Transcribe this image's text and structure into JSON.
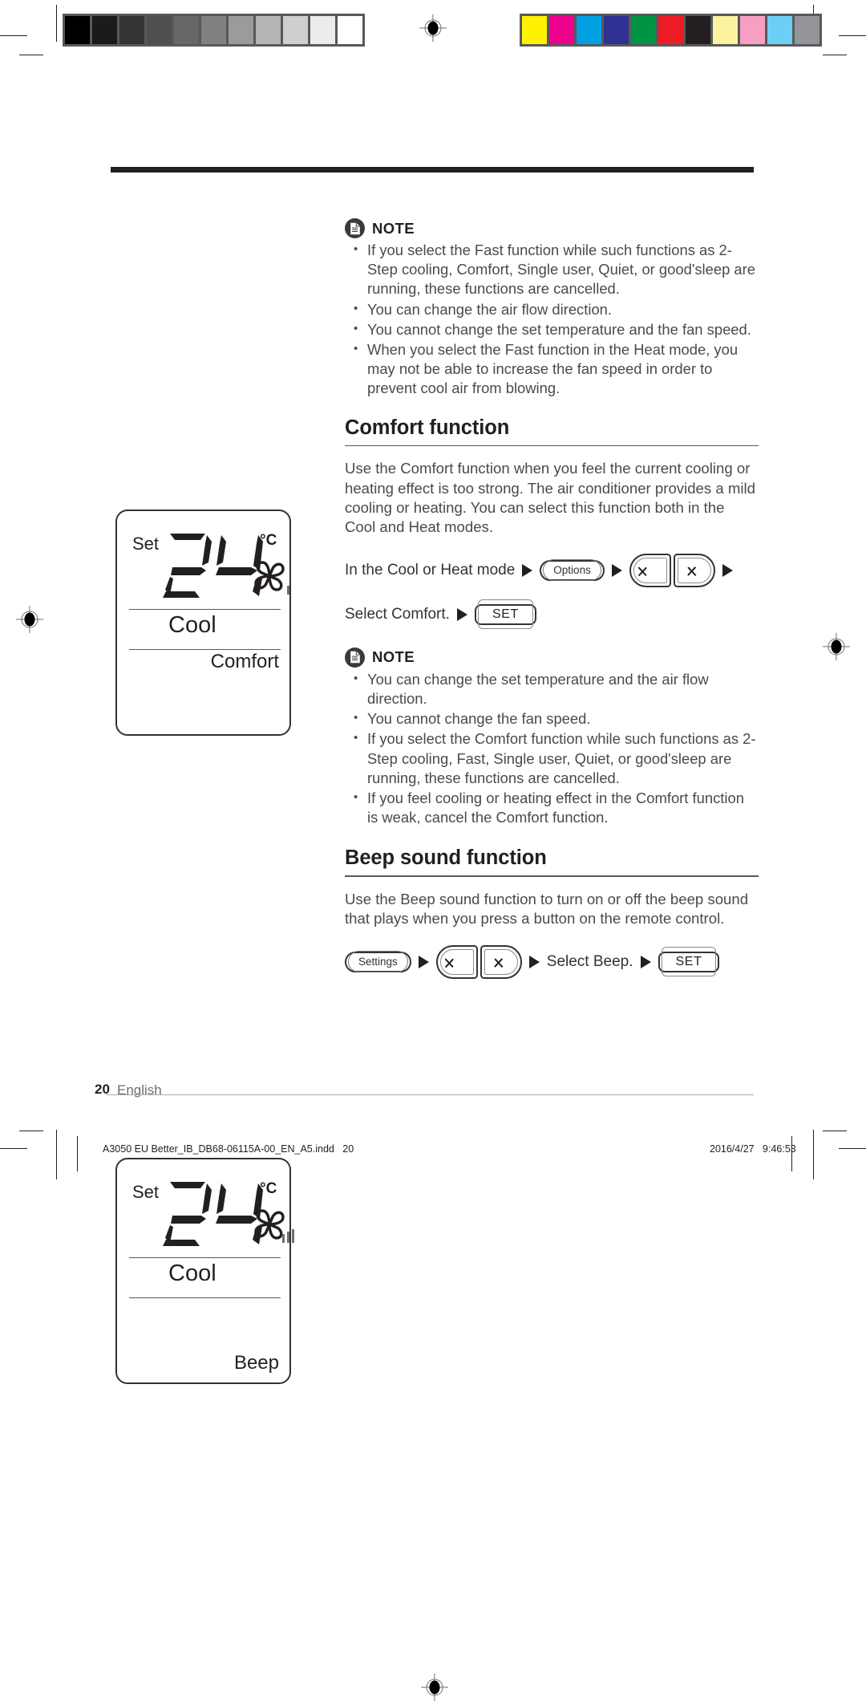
{
  "page": {
    "number": "20",
    "language": "English"
  },
  "prepress": {
    "grayscale_swatches": [
      "#000000",
      "#1c1b1b",
      "#343434",
      "#4f4f4f",
      "#676767",
      "#818181",
      "#9b9b9b",
      "#b5b5b5",
      "#cfcfcf",
      "#ececec",
      "#ffffff"
    ],
    "color_swatches": [
      "#fff200",
      "#ec008c",
      "#00a0e3",
      "#2e3192",
      "#009543",
      "#ed1c24",
      "#231f20",
      "#fdf2a0",
      "#f79fc2",
      "#6dcff6",
      "#939598"
    ],
    "registration_mark": "registration-target",
    "imprint_filename": "A3050 EU Better_IB_DB68-06115A-00_EN_A5.indd",
    "imprint_page": "20",
    "imprint_date": "2016/4/27",
    "imprint_time": "9:46:53"
  },
  "note_top": {
    "icon": "document-note-icon",
    "title": "NOTE",
    "bullets": [
      "If you select the Fast function while such functions as 2-Step cooling, Comfort, Single user, Quiet, or good'sleep are running, these functions are cancelled.",
      "You can change the air flow direction.",
      "You cannot change the set temperature and the fan speed.",
      "When you select the Fast function in the Heat mode, you may not be able to increase the fan speed in order to prevent cool air from blowing."
    ]
  },
  "comfort_section": {
    "heading": "Comfort function",
    "body": "Use the Comfort function when you feel the current cooling or heating effect is too strong. The air conditioner provides a mild cooling or heating. You can select this function both in the Cool and Heat modes.",
    "step_row_1": {
      "lead_text": "In the Cool or Heat mode",
      "options_button": "Options",
      "left_chevron": "‹",
      "right_chevron": "›"
    },
    "step_row_2": {
      "lead_text": "Select Comfort.",
      "set_button": "SET"
    }
  },
  "note_middle": {
    "icon": "document-note-icon",
    "title": "NOTE",
    "bullets": [
      "You can change the set temperature and the air flow direction.",
      "You cannot change the fan speed.",
      "If you select the Comfort function while such functions as 2-Step cooling, Fast, Single user, Quiet, or good'sleep are running, these functions are cancelled.",
      "If you feel cooling or heating effect in the Comfort function is weak, cancel the Comfort function."
    ]
  },
  "beep_section": {
    "heading": "Beep sound function",
    "body": "Use the Beep sound function to turn on or off the beep sound that plays when you press a button on the remote control.",
    "step_row": {
      "settings_button": "Settings",
      "left_chevron": "‹",
      "right_chevron": "›",
      "lead_text": "Select Beep.",
      "set_button": "SET"
    }
  },
  "lcd_comfort": {
    "set_label": "Set",
    "temperature": "24",
    "unit": "°C",
    "fan_icon": "fan-pinwheel-icon",
    "fan_bars": 1,
    "mode": "Cool",
    "feature": "Comfort"
  },
  "lcd_beep": {
    "set_label": "Set",
    "temperature": "24",
    "unit": "°C",
    "fan_icon": "fan-pinwheel-icon",
    "fan_bars": 3,
    "mode": "Cool",
    "feature": "Beep"
  }
}
